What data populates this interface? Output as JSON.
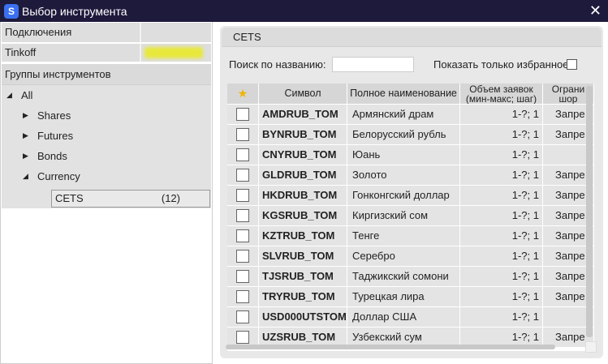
{
  "window": {
    "title": "Выбор инструмента",
    "close_label": "✕",
    "icon_letter": "S"
  },
  "connections": {
    "header": "Подключения",
    "rows": [
      {
        "name": "Tinkoff"
      }
    ]
  },
  "groups": {
    "header": "Группы инструментов",
    "root": "All",
    "items": [
      "Shares",
      "Futures",
      "Bonds",
      "Currency"
    ],
    "selected": {
      "label": "CETS",
      "count": "(12)"
    }
  },
  "panel": {
    "header": "CETS",
    "search_label": "Поиск по названию:",
    "search_value": "",
    "favorites_label": "Показать только избранное"
  },
  "table": {
    "columns": [
      "Символ",
      "Полное наименование",
      "Объем заявок",
      "(мин-макс; шаг)",
      "Ограни",
      "шор"
    ],
    "rows": [
      {
        "symbol": "AMDRUB_TOM",
        "name": "Армянский драм",
        "volume": "1-?; 1",
        "limit": "Запре"
      },
      {
        "symbol": "BYNRUB_TOM",
        "name": "Белорусский рубль",
        "volume": "1-?; 1",
        "limit": "Запре"
      },
      {
        "symbol": "CNYRUB_TOM",
        "name": "Юань",
        "volume": "1-?; 1",
        "limit": ""
      },
      {
        "symbol": "GLDRUB_TOM",
        "name": "Золото",
        "volume": "1-?; 1",
        "limit": "Запре"
      },
      {
        "symbol": "HKDRUB_TOM",
        "name": "Гонконгский доллар",
        "volume": "1-?; 1",
        "limit": "Запре"
      },
      {
        "symbol": "KGSRUB_TOM",
        "name": "Киргизский сом",
        "volume": "1-?; 1",
        "limit": "Запре"
      },
      {
        "symbol": "KZTRUB_TOM",
        "name": "Тенге",
        "volume": "1-?; 1",
        "limit": "Запре"
      },
      {
        "symbol": "SLVRUB_TOM",
        "name": "Серебро",
        "volume": "1-?; 1",
        "limit": "Запре"
      },
      {
        "symbol": "TJSRUB_TOM",
        "name": "Таджикский сомони",
        "volume": "1-?; 1",
        "limit": "Запре"
      },
      {
        "symbol": "TRYRUB_TOM",
        "name": "Турецкая лира",
        "volume": "1-?; 1",
        "limit": "Запре"
      },
      {
        "symbol": "USD000UTSTOM",
        "name": "Доллар США",
        "volume": "1-?; 1",
        "limit": ""
      },
      {
        "symbol": "UZSRUB_TOM",
        "name": "Узбекский сум",
        "volume": "1-?; 1",
        "limit": "Запре"
      }
    ]
  },
  "colors": {
    "titlebar": "#1e1a3c",
    "star": "#f0b400",
    "highlight": "#e8e83a"
  }
}
